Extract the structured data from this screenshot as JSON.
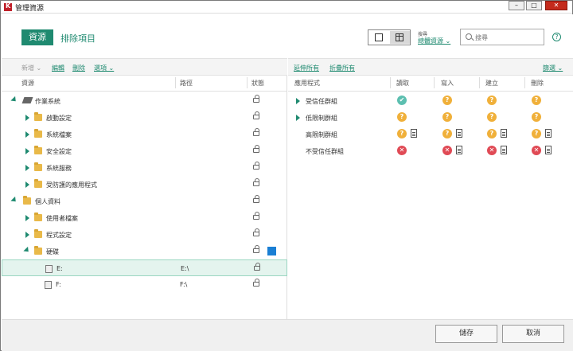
{
  "window": {
    "title": "管理資源",
    "minimize": "–",
    "maximize": "□",
    "close": "✕"
  },
  "header": {
    "tab_active": "資源",
    "tab_link": "排除項目",
    "search_scope_label": "搜尋",
    "search_scope": "總體資源",
    "search_placeholder": "搜尋",
    "help": "?"
  },
  "left_toolbar": {
    "add": "新增",
    "edit": "編輯",
    "delete": "刪除",
    "options": "選項"
  },
  "right_toolbar": {
    "expand_all": "延伸所有",
    "collapse_all": "折疊所有",
    "filter": "篩選"
  },
  "left_columns": {
    "resource": "資源",
    "path": "路徑",
    "status": "狀態"
  },
  "right_columns": {
    "application": "應用程式",
    "read": "讀取",
    "write": "寫入",
    "create": "建立",
    "delete": "刪除"
  },
  "resources": [
    {
      "label": "作業系統",
      "path": ""
    },
    {
      "label": "啟動設定",
      "path": ""
    },
    {
      "label": "系統檔案",
      "path": ""
    },
    {
      "label": "安全設定",
      "path": ""
    },
    {
      "label": "系統服務",
      "path": ""
    },
    {
      "label": "受防護的應用程式",
      "path": ""
    },
    {
      "label": "個人資料",
      "path": ""
    },
    {
      "label": "使用者檔案",
      "path": ""
    },
    {
      "label": "程式設定",
      "path": ""
    },
    {
      "label": "硬碟",
      "path": ""
    },
    {
      "label": "E:",
      "path": "E:\\"
    },
    {
      "label": "F:",
      "path": "F:\\"
    }
  ],
  "groups": [
    {
      "label": "受信任群組"
    },
    {
      "label": "低限制群組"
    },
    {
      "label": "高限制群組"
    },
    {
      "label": "不受信任群組"
    }
  ],
  "perm_glyphs": {
    "ok": "✔",
    "ask": "?",
    "deny": "✕"
  },
  "colors": {
    "accent": "#1f8a70",
    "allow": "#5cbfb0",
    "ask": "#f0b03a",
    "deny": "#e04a55",
    "status_blue": "#1a7fd4"
  },
  "footer": {
    "save": "儲存",
    "cancel": "取消"
  }
}
